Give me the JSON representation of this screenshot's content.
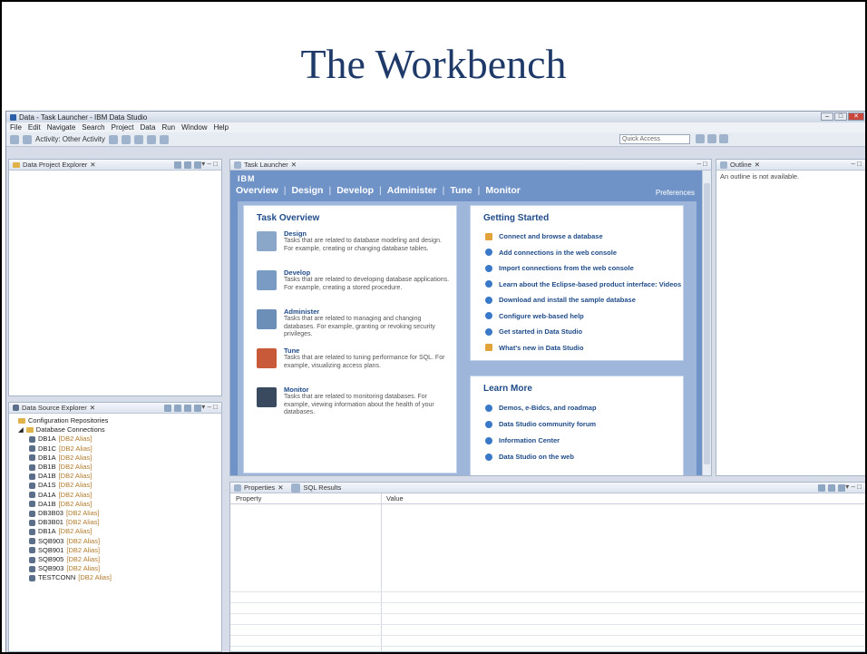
{
  "slide": {
    "title": "The Workbench"
  },
  "window": {
    "title": "Data - Task Launcher - IBM Data Studio",
    "menu": [
      "File",
      "Edit",
      "Navigate",
      "Search",
      "Project",
      "Data",
      "Run",
      "Window",
      "Help"
    ],
    "toolbar_text": "Activity: Other Activity",
    "quick_access": "Quick Access"
  },
  "project_explorer": {
    "tab": "Data Project Explorer"
  },
  "task_launcher": {
    "tab": "Task Launcher",
    "brand": "IBM",
    "tabs": [
      "Overview",
      "Design",
      "Develop",
      "Administer",
      "Tune",
      "Monitor"
    ],
    "preferences": "Preferences",
    "task_overview": {
      "heading": "Task Overview",
      "items": [
        {
          "title": "Design",
          "desc": "Tasks that are related to database modeling and design. For example, creating or changing database tables."
        },
        {
          "title": "Develop",
          "desc": "Tasks that are related to developing database applications. For example, creating a stored procedure."
        },
        {
          "title": "Administer",
          "desc": "Tasks that are related to managing and changing databases. For example, granting or revoking security privileges."
        },
        {
          "title": "Tune",
          "desc": "Tasks that are related to tuning performance for SQL. For example, visualizing access plans."
        },
        {
          "title": "Monitor",
          "desc": "Tasks that are related to monitoring databases. For example, viewing information about the health of your databases."
        }
      ]
    },
    "getting_started": {
      "heading": "Getting Started",
      "items": [
        "Connect and browse a database",
        "Add connections in the web console",
        "Import connections from the web console",
        "Learn about the Eclipse-based product interface: Videos",
        "Download and install the sample database",
        "Configure web-based help",
        "Get started in Data Studio",
        "What's new in Data Studio"
      ]
    },
    "learn_more": {
      "heading": "Learn More",
      "items": [
        "Demos, e-Bidcs, and roadmap",
        "Data Studio community forum",
        "Information Center",
        "Data Studio on the web"
      ]
    }
  },
  "outline": {
    "tab": "Outline",
    "message": "An outline is not available."
  },
  "data_source_explorer": {
    "tab": "Data Source Explorer",
    "folders": [
      "Configuration Repositories",
      "Database Connections"
    ],
    "connections": [
      {
        "name": "DB1A",
        "type": "[DB2 Alias]"
      },
      {
        "name": "DB1C",
        "type": "[DB2 Alias]"
      },
      {
        "name": "DB1A",
        "type": "[DB2 Alias]"
      },
      {
        "name": "DB1B",
        "type": "[DB2 Alias]"
      },
      {
        "name": "DA1B",
        "type": "[DB2 Alias]"
      },
      {
        "name": "DA1S",
        "type": "[DB2 Alias]"
      },
      {
        "name": "DA1A",
        "type": "[DB2 Alias]"
      },
      {
        "name": "DA1B",
        "type": "[DB2 Alias]"
      },
      {
        "name": "DB3B03",
        "type": "[DB2 Alias]"
      },
      {
        "name": "DB3B01",
        "type": "[DB2 Alias]"
      },
      {
        "name": "DB1A",
        "type": "[DB2 Alias]"
      },
      {
        "name": "SQB903",
        "type": "[DB2 Alias]"
      },
      {
        "name": "SQB901",
        "type": "[DB2 Alias]"
      },
      {
        "name": "SQB905",
        "type": "[DB2 Alias]"
      },
      {
        "name": "SQB903",
        "type": "[DB2 Alias]"
      },
      {
        "name": "TESTCONN",
        "type": "[DB2 Alias]"
      }
    ]
  },
  "properties": {
    "tabs": [
      "Properties",
      "SQL Results"
    ],
    "columns": [
      "Property",
      "Value"
    ]
  },
  "colors": {
    "title": "#1f3a68",
    "launcher": "#6f93c7",
    "link": "#1f4b88"
  }
}
